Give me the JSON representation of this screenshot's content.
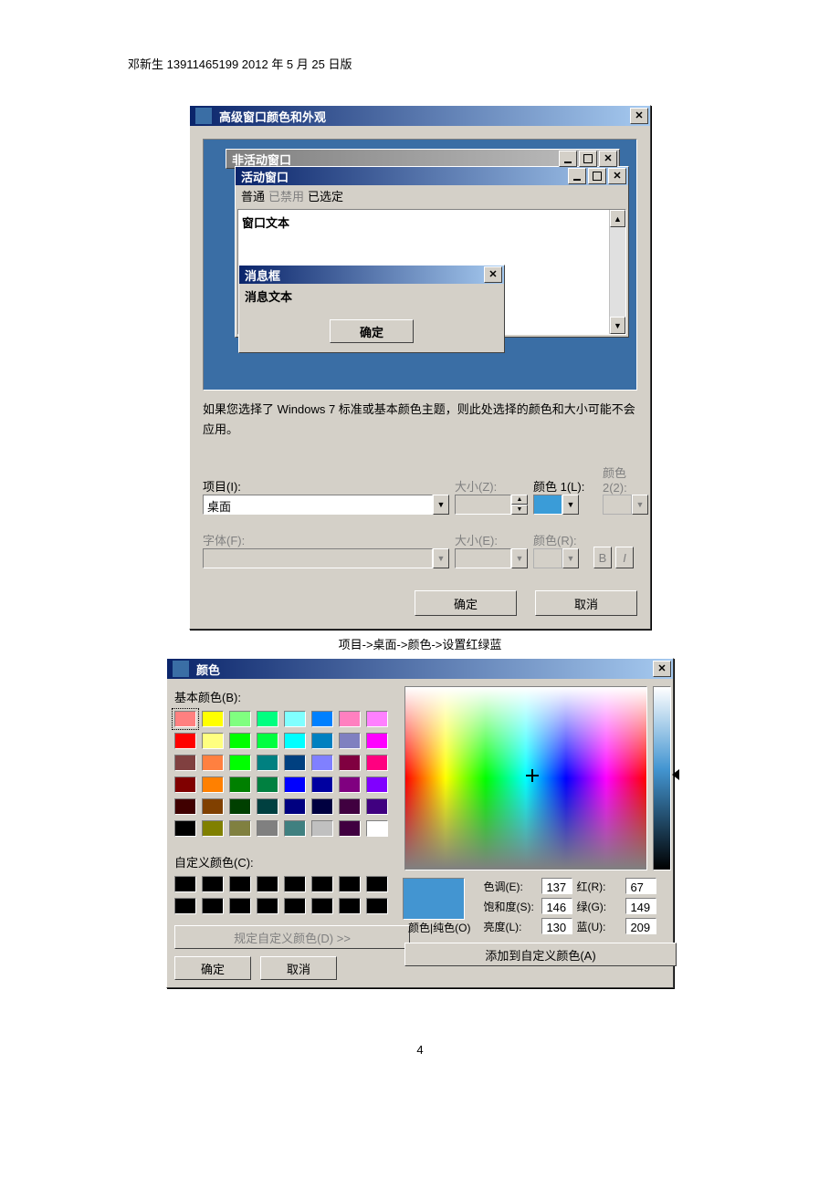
{
  "doc": {
    "header": "邓新生 13911465199 2012 年 5 月 25 日版",
    "caption_between": "项目->桌面->颜色->设置红绿蓝",
    "page_number": "4"
  },
  "dlg1": {
    "title": "高级窗口颜色和外观",
    "preview": {
      "inactive_title": "非活动窗口",
      "active_title": "活动窗口",
      "menu_normal": "普通",
      "menu_disabled": "已禁用",
      "menu_selected": "已选定",
      "window_text": "窗口文本",
      "msgbox_title": "消息框",
      "msgbox_text": "消息文本",
      "msgbox_ok": "确定"
    },
    "note": "如果您选择了 Windows 7 标准或基本颜色主题，则此处选择的颜色和大小可能不会应用。",
    "labels": {
      "item": "项目(I):",
      "size_z": "大小(Z):",
      "color1": "颜色 1(L):",
      "color2": "颜色 2(2):",
      "font": "字体(F):",
      "size_e": "大小(E):",
      "color_r": "颜色(R):",
      "bold": "B",
      "italic": "I"
    },
    "item_value": "桌面",
    "ok": "确定",
    "cancel": "取消"
  },
  "dlg2": {
    "title": "颜色",
    "basic_label": "基本颜色(B):",
    "custom_label": "自定义颜色(C):",
    "define_custom": "规定自定义颜色(D) >>",
    "ok": "确定",
    "cancel": "取消",
    "color_solid": "颜色|纯色(O)",
    "hue_l": "色调(E):",
    "sat_l": "饱和度(S):",
    "lum_l": "亮度(L):",
    "r_l": "红(R):",
    "g_l": "绿(G):",
    "b_l": "蓝(U):",
    "hue": "137",
    "sat": "146",
    "lum": "130",
    "r": "67",
    "g": "149",
    "b": "209",
    "add": "添加到自定义颜色(A)",
    "basic_colors": [
      "#ff8080",
      "#ffff00",
      "#80ff80",
      "#00ff80",
      "#80ffff",
      "#0080ff",
      "#ff80c0",
      "#ff80ff",
      "#ff0000",
      "#ffff80",
      "#00ff00",
      "#00ff40",
      "#00ffff",
      "#0080c0",
      "#8080c0",
      "#ff00ff",
      "#804040",
      "#ff8040",
      "#00ff00",
      "#008080",
      "#004080",
      "#8080ff",
      "#800040",
      "#ff0080",
      "#800000",
      "#ff8000",
      "#008000",
      "#008040",
      "#0000ff",
      "#0000a0",
      "#800080",
      "#8000ff",
      "#400000",
      "#804000",
      "#004000",
      "#004040",
      "#000080",
      "#000040",
      "#400040",
      "#400080",
      "#000000",
      "#808000",
      "#808040",
      "#808080",
      "#408080",
      "#c0c0c0",
      "#400040",
      "#ffffff"
    ]
  }
}
